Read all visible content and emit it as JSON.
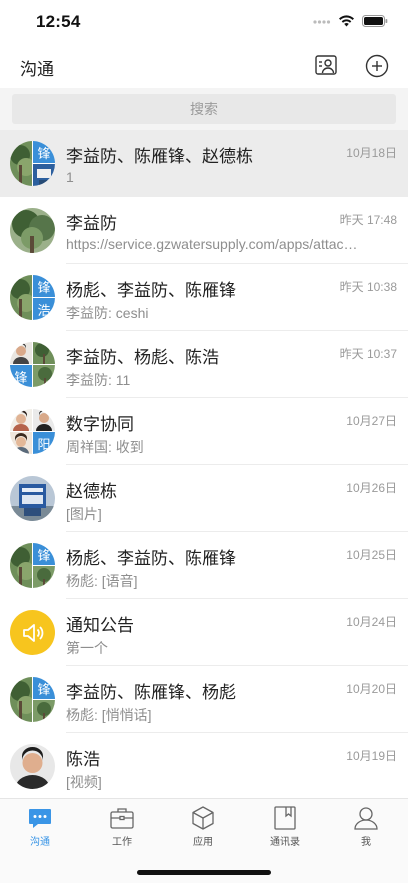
{
  "status_bar": {
    "time": "12:54"
  },
  "nav": {
    "title": "沟通",
    "contact_icon": "contact-card-icon",
    "add_icon": "plus-circle-icon"
  },
  "search": {
    "placeholder": "搜索",
    "icon": "search-icon"
  },
  "chats": [
    {
      "name": "李益防、陈雁锋、赵德栋",
      "preview": "1",
      "time": "10月18日",
      "avatar": [
        "photo-tree",
        "锋",
        "photo-sign"
      ],
      "selected": true
    },
    {
      "name": "李益防",
      "preview": "https://service.gzwatersupply.com/apps/attach...",
      "time": "昨天 17:48",
      "avatar": [
        "photo-tree"
      ]
    },
    {
      "name": "杨彪、李益防、陈雁锋",
      "preview": "李益防: ceshi",
      "time": "昨天 10:38",
      "avatar": [
        "photo-tree",
        "锋",
        "浩"
      ]
    },
    {
      "name": "李益防、杨彪、陈浩",
      "preview": "李益防: 11",
      "time": "昨天 10:37",
      "avatar": [
        "photo-person",
        "photo-tree",
        "锋",
        "photo-tree"
      ]
    },
    {
      "name": "数字协同",
      "preview": "周祥国: 收到",
      "time": "10月27日",
      "avatar": [
        "photo-person",
        "photo-person",
        "photo-person",
        "阳"
      ]
    },
    {
      "name": "赵德栋",
      "preview": "[图片]",
      "time": "10月26日",
      "avatar": [
        "photo-sign"
      ]
    },
    {
      "name": "杨彪、李益防、陈雁锋",
      "preview": "杨彪: [语音]",
      "time": "10月25日",
      "avatar": [
        "photo-tree",
        "锋",
        "photo-tree"
      ]
    },
    {
      "name": "通知公告",
      "preview": "第一个",
      "time": "10月24日",
      "avatar": [
        "speaker-icon"
      ]
    },
    {
      "name": "李益防、陈雁锋、杨彪",
      "preview": "杨彪: [悄悄话]",
      "time": "10月20日",
      "avatar": [
        "photo-tree",
        "锋",
        "photo-tree"
      ]
    },
    {
      "name": "陈浩",
      "preview": "[视频]",
      "time": "10月19日",
      "avatar": [
        "photo-person"
      ]
    }
  ],
  "tabs": [
    {
      "label": "沟通",
      "icon": "chat-bubble-icon",
      "active": true
    },
    {
      "label": "工作",
      "icon": "briefcase-icon"
    },
    {
      "label": "应用",
      "icon": "cube-icon"
    },
    {
      "label": "通讯录",
      "icon": "address-book-icon"
    },
    {
      "label": "我",
      "icon": "person-icon"
    }
  ],
  "colors": {
    "accent": "#3a95e6",
    "tile_blue": "#3a8fd8",
    "notice_yellow": "#f7c51e",
    "selected_bg": "#ececec"
  }
}
